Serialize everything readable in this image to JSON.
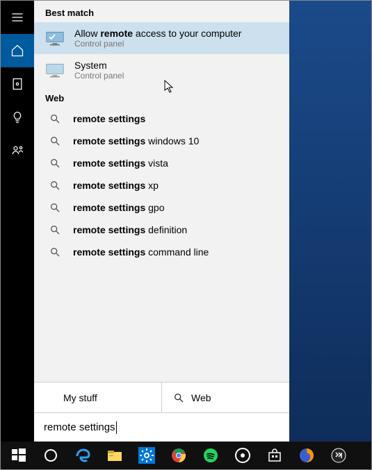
{
  "section_best": "Best match",
  "section_web": "Web",
  "results": [
    {
      "title_pre": "Allow ",
      "title_bold": "remote",
      "title_post": " access to your computer",
      "sub": "Control panel"
    },
    {
      "title_pre": "",
      "title_bold": "",
      "title_post": "System",
      "sub": "Control panel"
    }
  ],
  "web": [
    {
      "bold": "remote settings",
      "rest": ""
    },
    {
      "bold": "remote settings",
      "rest": " windows 10"
    },
    {
      "bold": "remote settings",
      "rest": " vista"
    },
    {
      "bold": "remote settings",
      "rest": " xp"
    },
    {
      "bold": "remote settings",
      "rest": " gpo"
    },
    {
      "bold": "remote settings",
      "rest": " definition"
    },
    {
      "bold": "remote settings",
      "rest": " command line"
    }
  ],
  "filters": {
    "mystuff": "My stuff",
    "web": "Web"
  },
  "search_value": "remote settings"
}
